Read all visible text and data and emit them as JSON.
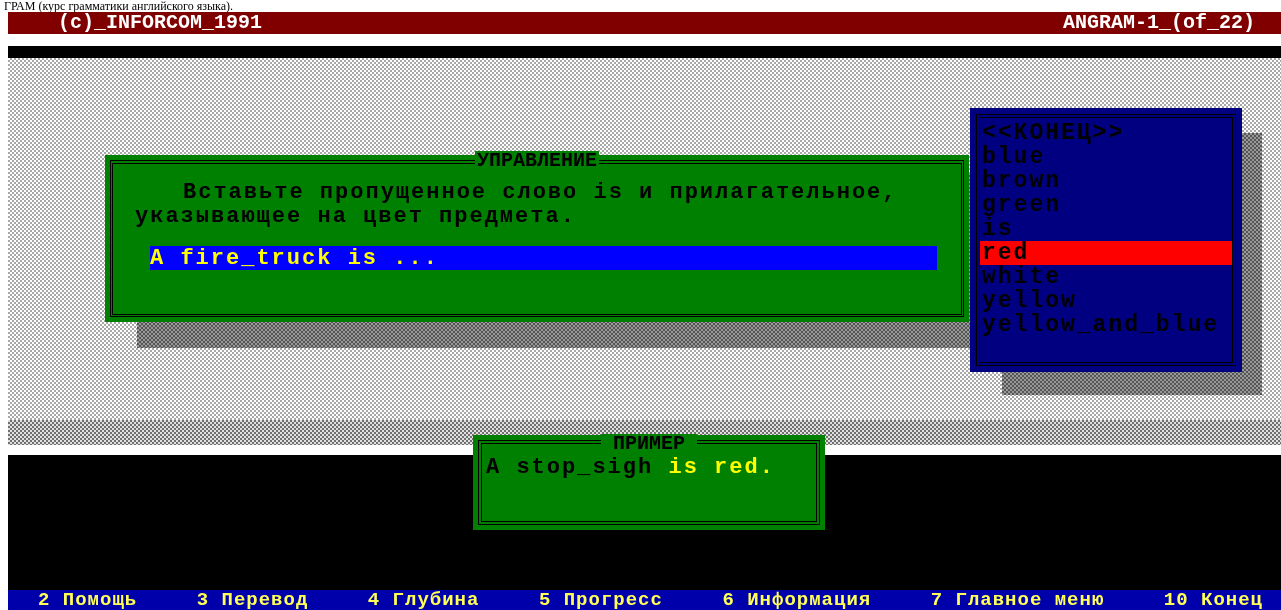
{
  "caption": "ГРАМ (курс грамматики английского языка).",
  "title_bar": {
    "left": "(c)_INFORCOM_1991",
    "right": "ANGRAM-1_(of_22)"
  },
  "instruction_window": {
    "title": "УПРАВЛЕНИЕ",
    "text": "Вставьте пропущенное слово is и прилагательное, указывающее на цвет предмета.",
    "answer": "A fire_truck is ..."
  },
  "word_list": [
    {
      "label": "<<КОНЕЦ>>",
      "selected": false
    },
    {
      "label": "blue",
      "selected": false
    },
    {
      "label": "brown",
      "selected": false
    },
    {
      "label": "green",
      "selected": false
    },
    {
      "label": "is",
      "selected": false
    },
    {
      "label": "red",
      "selected": true
    },
    {
      "label": "white",
      "selected": false
    },
    {
      "label": "yellow",
      "selected": false
    },
    {
      "label": "yellow_and_blue",
      "selected": false
    }
  ],
  "example_window": {
    "title": "ПРИМЕР",
    "parts": [
      {
        "text": "A stop_sigh ",
        "highlight": false
      },
      {
        "text": "is red.",
        "highlight": true
      }
    ]
  },
  "function_keys": [
    {
      "key": "2",
      "label": "Помощь"
    },
    {
      "key": "3",
      "label": "Перевод"
    },
    {
      "key": "4",
      "label": "Глубина"
    },
    {
      "key": "5",
      "label": "Прогресс"
    },
    {
      "key": "6",
      "label": "Информация"
    },
    {
      "key": "7",
      "label": "Главное меню"
    },
    {
      "key": "10",
      "label": "Конец"
    }
  ]
}
